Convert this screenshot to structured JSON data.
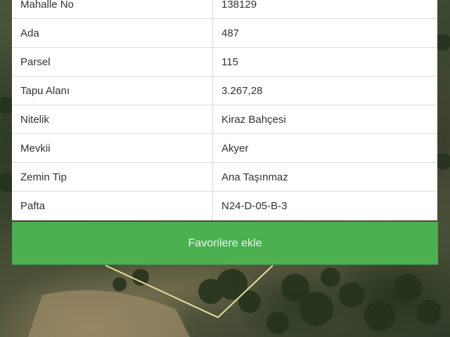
{
  "details": {
    "rows": [
      {
        "label": "Mahalle No",
        "value": "138129"
      },
      {
        "label": "Ada",
        "value": "487"
      },
      {
        "label": "Parsel",
        "value": "115"
      },
      {
        "label": "Tapu Alanı",
        "value": "3.267,28"
      },
      {
        "label": "Nitelik",
        "value": "Kiraz Bahçesi"
      },
      {
        "label": "Mevkii",
        "value": "Akyer"
      },
      {
        "label": "Zemin Tip",
        "value": "Ana Taşınmaz"
      },
      {
        "label": "Pafta",
        "value": "N24-D-05-B-3"
      }
    ]
  },
  "actions": {
    "favorite_label": "Favorilere ekle"
  },
  "colors": {
    "button_green": "#4caf50",
    "parcel_outline": "#e8dca0"
  }
}
